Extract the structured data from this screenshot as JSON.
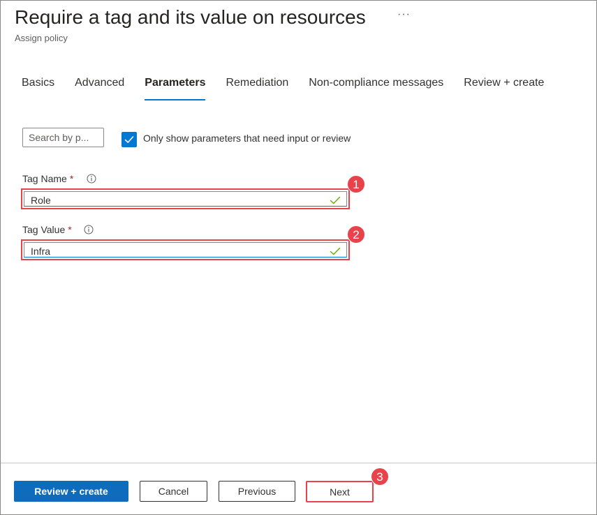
{
  "header": {
    "title": "Require a tag and its value on resources",
    "more_label": "···",
    "subtitle": "Assign policy"
  },
  "tabs": [
    {
      "label": "Basics",
      "active": false
    },
    {
      "label": "Advanced",
      "active": false
    },
    {
      "label": "Parameters",
      "active": true
    },
    {
      "label": "Remediation",
      "active": false
    },
    {
      "label": "Non-compliance messages",
      "active": false
    },
    {
      "label": "Review + create",
      "active": false
    }
  ],
  "filters": {
    "search_placeholder": "Search by p...",
    "only_show_label": "Only show parameters that need input or review",
    "only_show_checked": true
  },
  "fields": {
    "tag_name": {
      "label": "Tag Name",
      "required_mark": "*",
      "value": "Role",
      "badge": "1"
    },
    "tag_value": {
      "label": "Tag Value",
      "required_mark": "*",
      "value": "Infra",
      "badge": "2"
    }
  },
  "footer": {
    "review_create_label": "Review + create",
    "cancel_label": "Cancel",
    "previous_label": "Previous",
    "next_label": "Next",
    "next_badge": "3"
  },
  "colors": {
    "accent": "#0078d4",
    "primary_button": "#0f6cbd",
    "annotation_red": "#e8434a",
    "valid_green": "#5db300",
    "required_red": "#a4262c"
  }
}
